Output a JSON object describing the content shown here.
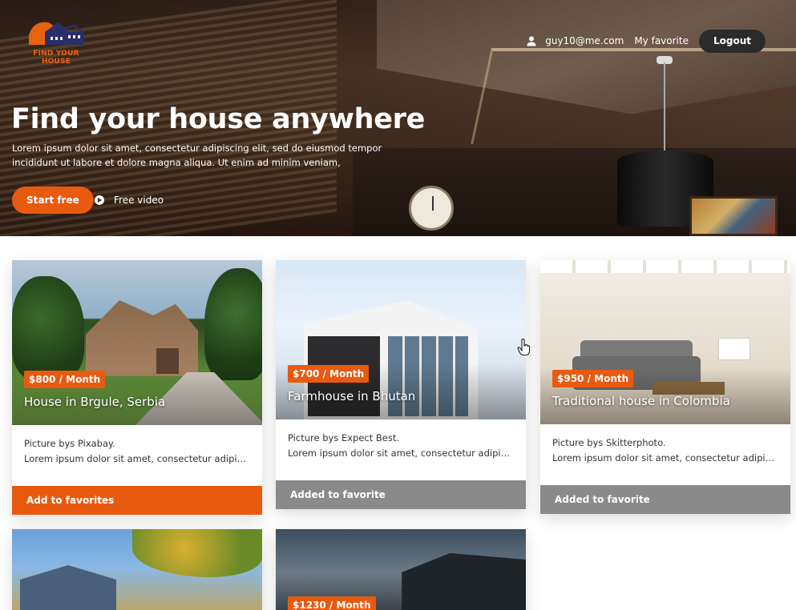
{
  "brand": {
    "logo_text": "FIND YOUR HOUSE",
    "accent": "#e85a10"
  },
  "nav": {
    "email": "guy10@me.com",
    "favorite_link": "My favorite",
    "logout": "Logout"
  },
  "hero": {
    "title": "Find your house anywhere",
    "description": "Lorem ipsum dolor sit amet, consectetur adipiscing elit, sed do eiusmod tempor incididunt ut labore et dolore magna aliqua. Ut enim ad minim veniam,",
    "start_button": "Start free",
    "video_link": "Free video"
  },
  "cards": [
    {
      "price": "$800 / Month",
      "title": "House in Brgule, Serbia",
      "credit": "Picture bys Pixabay.",
      "text": "Lorem ipsum dolor sit amet, consectetur adipiscing elit",
      "action": "Add to favorites"
    },
    {
      "price": "$700 / Month",
      "title": "Farmhouse in Bhutan",
      "credit": "Picture bys Expect Best.",
      "text": "Lorem ipsum dolor sit amet, consectetur adipiscing elit",
      "action": "Added to favorite"
    },
    {
      "price": "$950 / Month",
      "title": "Traditional house in Colombia",
      "credit": "Picture bys Skitterphoto.",
      "text": "Lorem ipsum dolor sit amet, consectetur adipiscing elit",
      "action": "Added to favorite"
    },
    {
      "price": "",
      "title": "",
      "credit": "",
      "text": "",
      "action": ""
    },
    {
      "price": "$1230 / Month",
      "title": "",
      "credit": "",
      "text": "",
      "action": ""
    }
  ]
}
